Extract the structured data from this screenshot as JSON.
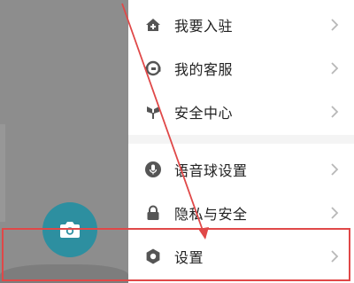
{
  "menu": {
    "items": [
      {
        "label": "我要入驻",
        "icon": "house-plus-icon"
      },
      {
        "label": "我的客服",
        "icon": "customer-service-icon"
      },
      {
        "label": "安全中心",
        "icon": "shield-tree-icon"
      },
      {
        "label": "语音球设置",
        "icon": "microphone-icon"
      },
      {
        "label": "隐私与安全",
        "icon": "lock-icon"
      },
      {
        "label": "设置",
        "icon": "gear-icon"
      }
    ]
  },
  "colors": {
    "overlay": "#8d8d8d",
    "fab": "#2d8fa0",
    "icon": "#555555",
    "chevron": "#b8b8b8",
    "annotation": "#e04848"
  }
}
